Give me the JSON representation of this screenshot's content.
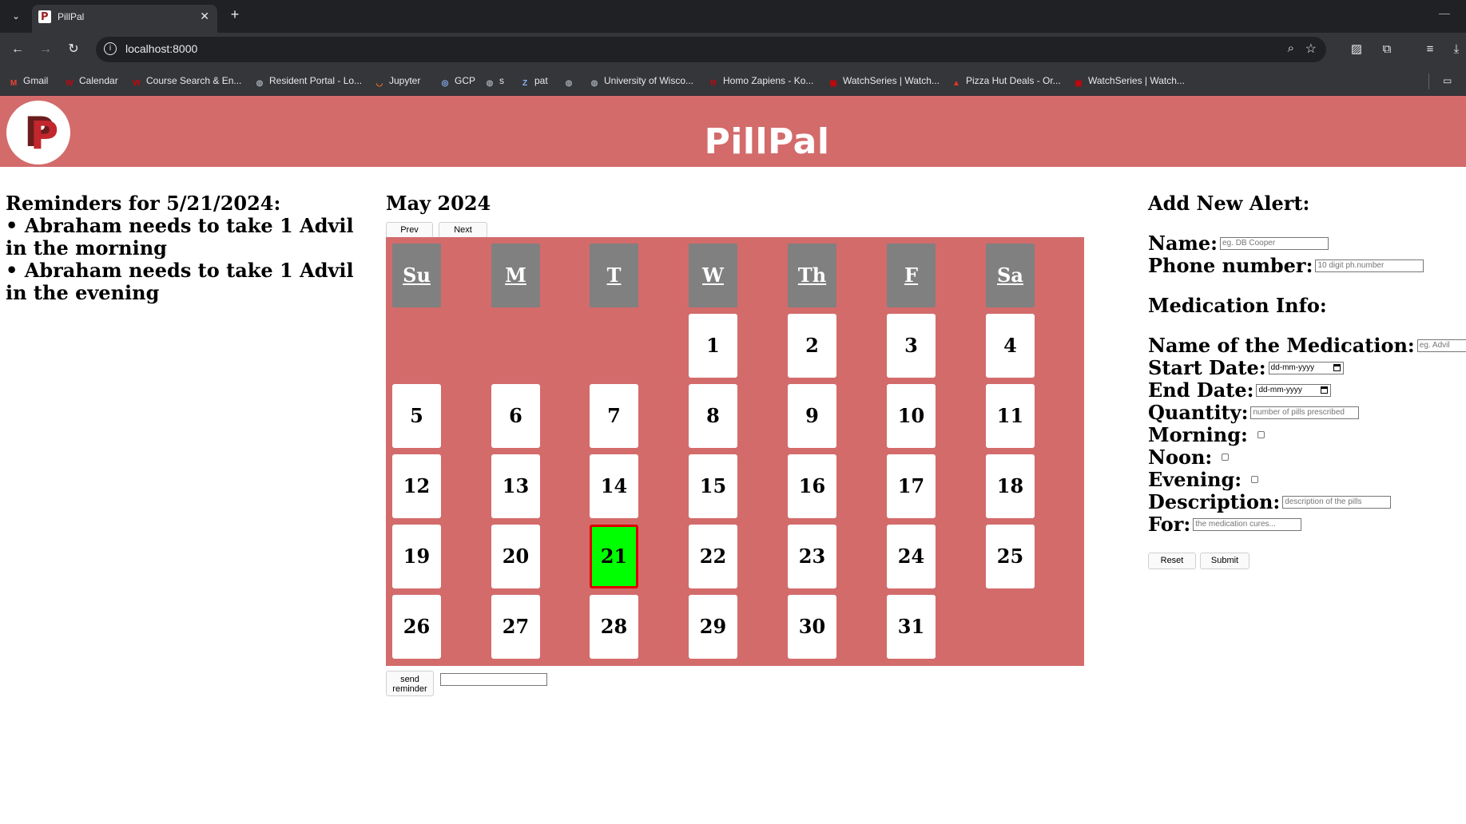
{
  "browser": {
    "tab_title": "PillPal",
    "tab_close": "✕",
    "new_tab": "+",
    "url": "localhost:8000",
    "bookmarks": [
      {
        "label": "Gmail",
        "icon": "gmail-icon",
        "glyph": "M",
        "color": "#ea4335"
      },
      {
        "label": "Calendar",
        "icon": "uw-icon",
        "glyph": "W",
        "color": "#c5050c"
      },
      {
        "label": "Course Search & En...",
        "icon": "uw-icon",
        "glyph": "W",
        "color": "#c5050c"
      },
      {
        "label": "Resident Portal - Lo...",
        "icon": "globe-icon",
        "glyph": "◍",
        "color": "#9aa0a6"
      },
      {
        "label": "Jupyter",
        "icon": "jupyter-icon",
        "glyph": "◡",
        "color": "#f37726"
      },
      {
        "label": "GCP",
        "icon": "gcp-icon",
        "glyph": "◎",
        "color": "#8ab4f8"
      },
      {
        "label": "s",
        "icon": "globe-icon",
        "glyph": "◍",
        "color": "#9aa0a6"
      },
      {
        "label": "pat",
        "icon": "pat-icon",
        "glyph": "Z",
        "color": "#8ab4f8"
      },
      {
        "label": "",
        "icon": "globe-icon",
        "glyph": "◍",
        "color": "#9aa0a6"
      },
      {
        "label": "University of Wisco...",
        "icon": "globe-icon",
        "glyph": "◍",
        "color": "#9aa0a6"
      },
      {
        "label": "Homo Zapiens - Ko...",
        "icon": "r-icon",
        "glyph": "R",
        "color": "#c5050c"
      },
      {
        "label": "WatchSeries | Watch...",
        "icon": "watchseries-icon",
        "glyph": "▣",
        "color": "#c5050c"
      },
      {
        "label": "Pizza Hut Deals - Or...",
        "icon": "pizzahut-icon",
        "glyph": "▲",
        "color": "#ee3124"
      },
      {
        "label": "WatchSeries | Watch...",
        "icon": "watchseries-icon",
        "glyph": "▣",
        "color": "#c5050c"
      }
    ]
  },
  "header": {
    "title": "PillPal"
  },
  "reminders": {
    "heading": "Reminders for 5/21/2024:",
    "items": [
      "• Abraham needs to take 1 Advil in the morning",
      "• Abraham needs to take 1 Advil in the evening"
    ]
  },
  "calendar": {
    "title": "May 2024",
    "prev_label": "Prev",
    "next_label": "Next",
    "weekdays": [
      "Su",
      "M",
      "T",
      "W",
      "Th",
      "F",
      "Sa"
    ],
    "first_weekday": 3,
    "days": [
      "1",
      "2",
      "3",
      "4",
      "5",
      "6",
      "7",
      "8",
      "9",
      "10",
      "11",
      "12",
      "13",
      "14",
      "15",
      "16",
      "17",
      "18",
      "19",
      "20",
      "21",
      "22",
      "23",
      "24",
      "25",
      "26",
      "27",
      "28",
      "29",
      "30",
      "31"
    ],
    "selected_day": "21",
    "send_label": "send reminder"
  },
  "form": {
    "heading": "Add New Alert:",
    "name_label": "Name:",
    "name_placeholder": "eg. DB Cooper",
    "phone_label": "Phone number:",
    "phone_placeholder": "10 digit ph.number",
    "med_heading": "Medication Info:",
    "med_name_label": "Name of the Medication:",
    "med_name_placeholder": "eg. Advil",
    "start_label": "Start Date:",
    "start_value": "dd-mm-yyyy",
    "end_label": "End Date:",
    "end_value": "dd-mm-yyyy",
    "quantity_label": "Quantity:",
    "quantity_placeholder": "number of pills prescribed",
    "morning_label": "Morning:",
    "noon_label": "Noon:",
    "evening_label": "Evening:",
    "description_label": "Description:",
    "description_placeholder": "description of the pills",
    "for_label": "For:",
    "for_placeholder": "the medication cures...",
    "reset_label": "Reset",
    "submit_label": "Submit"
  }
}
